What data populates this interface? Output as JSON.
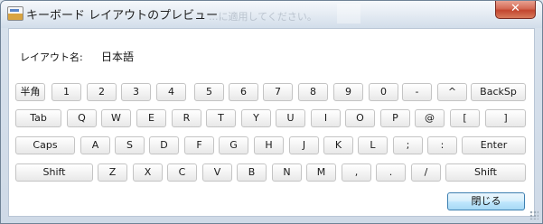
{
  "window": {
    "title": "キーボード レイアウトのプレビュー",
    "background_ghost_text": "...に適用してください。",
    "close_glyph": "✕"
  },
  "layout": {
    "label": "レイアウト名:",
    "value": "日本語"
  },
  "keyboard": {
    "rows": [
      [
        "半角",
        "1",
        "2",
        "3",
        "4",
        "5",
        "6",
        "7",
        "8",
        "9",
        "0",
        "-",
        "^",
        "BackSp"
      ],
      [
        "Tab",
        "Q",
        "W",
        "E",
        "R",
        "T",
        "Y",
        "U",
        "I",
        "O",
        "P",
        "@",
        "[",
        "]"
      ],
      [
        "Caps",
        "A",
        "S",
        "D",
        "F",
        "G",
        "H",
        "J",
        "K",
        "L",
        ";",
        ":",
        "Enter"
      ],
      [
        "Shift",
        "Z",
        "X",
        "C",
        "V",
        "B",
        "N",
        "M",
        ",",
        ".",
        "/",
        "Shift"
      ]
    ]
  },
  "buttons": {
    "close": "閉じる"
  },
  "colors": {
    "accent_button_border": "#3c7fb1",
    "close_button": "#c3462f"
  }
}
